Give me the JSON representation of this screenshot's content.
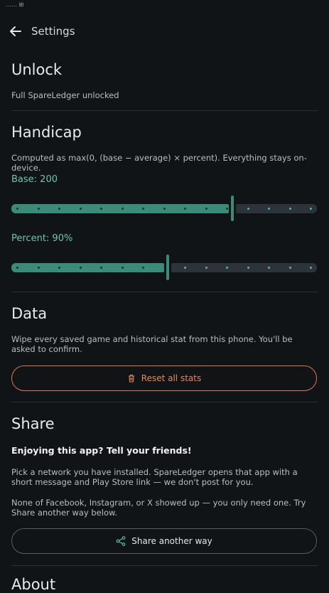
{
  "status": {
    "text": "…… ⊞"
  },
  "header": {
    "title": "Settings"
  },
  "unlock": {
    "heading": "Unlock",
    "text": "Full SpareLedger unlocked"
  },
  "handicap": {
    "heading": "Handicap",
    "description": "Computed as max(0, (base − average) × percent). Everything stays on-device.",
    "base_label": "Base: 200",
    "base_fraction": 0.72,
    "percent_label": "Percent: 90%",
    "percent_fraction": 0.51
  },
  "data": {
    "heading": "Data",
    "description": "Wipe every saved game and historical stat from this phone. You'll be asked to confirm.",
    "reset_label": "Reset all stats"
  },
  "share": {
    "heading": "Share",
    "tagline": "Enjoying this app? Tell your friends!",
    "info": "Pick a network you have installed. SpareLedger opens that app with a short message and Play Store link — we don't post for you.",
    "fallback": "None of Facebook, Instagram, or X showed up — you only need one. Try Share another way below.",
    "button_label": "Share another way"
  },
  "about": {
    "heading": "About"
  },
  "colors": {
    "accent": "#3a8c78",
    "danger": "#d97a4a",
    "background": "#111417"
  }
}
